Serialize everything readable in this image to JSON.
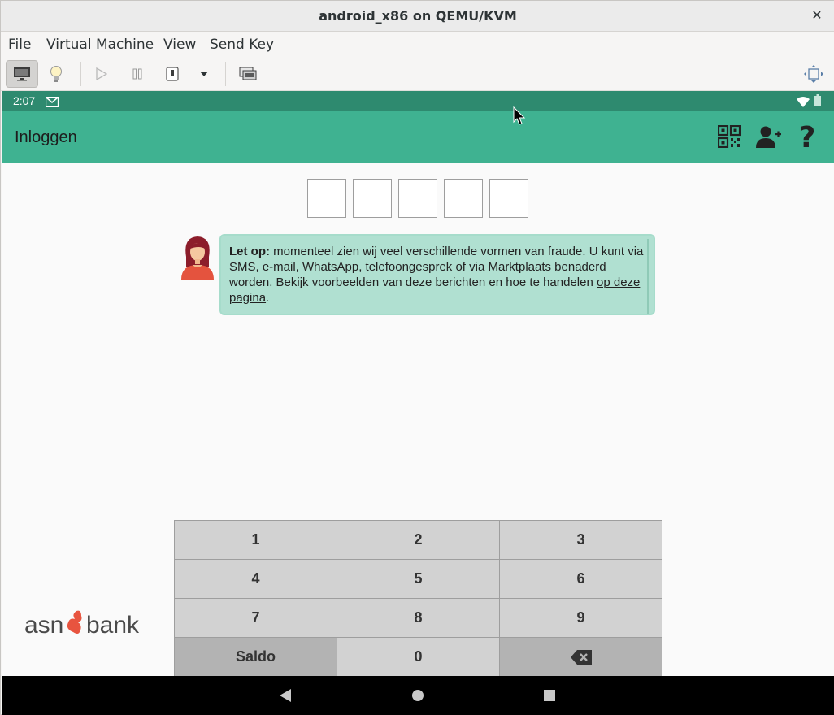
{
  "window": {
    "title": "android_x86 on QEMU/KVM",
    "close_glyph": "✕"
  },
  "menubar": {
    "items": [
      "File",
      "Virtual Machine",
      "View",
      "Send Key"
    ]
  },
  "toolbar": {
    "icons": [
      "monitor-icon",
      "lightbulb-icon",
      "play-icon",
      "pause-icon",
      "power-icon",
      "dropdown-icon",
      "screenshot-icon",
      "fullscreen-icon"
    ]
  },
  "android": {
    "status_time": "2:07",
    "appbar_title": "Inloggen",
    "appbar_icons": [
      "qr-code-icon",
      "add-user-icon",
      "help-icon"
    ],
    "pin_boxes": 5,
    "notice": {
      "bold": "Let op:",
      "text": " momenteel zien wij veel verschillende vormen van fraude. U kunt via SMS, e-mail, WhatsApp, telefoongesprek of via Marktplaats benaderd worden. Bekijk voorbeelden van deze berichten en hoe te handelen ",
      "link": "op deze pagina",
      "end": "."
    },
    "keypad": {
      "keys": [
        "1",
        "2",
        "3",
        "4",
        "5",
        "6",
        "7",
        "8",
        "9",
        "Saldo",
        "0",
        "⌫"
      ]
    },
    "logo": {
      "text_left": "asn",
      "text_right": "bank",
      "accent_color": "#e8543f"
    },
    "colors": {
      "appbar": "#3fb291",
      "statusbar": "#2e8a6f",
      "bubble": "#b0e0d1"
    }
  }
}
